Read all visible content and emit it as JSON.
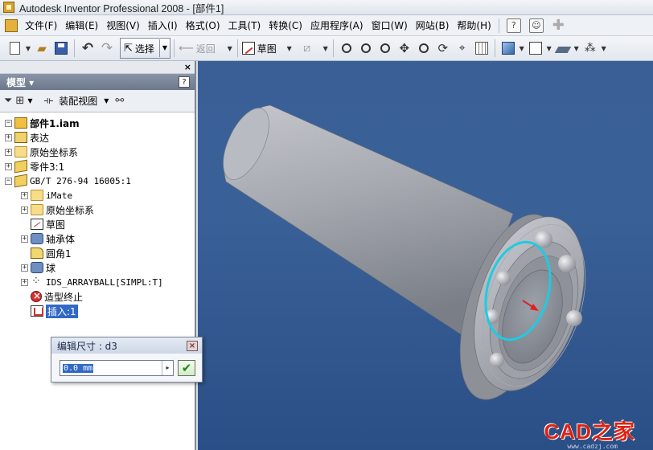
{
  "window": {
    "title": "Autodesk Inventor Professional 2008 - [部件1]"
  },
  "menu": {
    "items": [
      "文件(F)",
      "编辑(E)",
      "视图(V)",
      "插入(I)",
      "格式(O)",
      "工具(T)",
      "转换(C)",
      "应用程序(A)",
      "窗口(W)",
      "网站(B)",
      "帮助(H)"
    ],
    "help_icon": "?"
  },
  "toolbar": {
    "select_label": "选择",
    "back_label": "返回",
    "sketch_label": "草图"
  },
  "browser": {
    "header": "模型 ▾",
    "help": "?",
    "close": "×",
    "assembly_view_label": "装配视图",
    "tree": [
      {
        "label": "部件1.iam"
      },
      {
        "label": "表达"
      },
      {
        "label": "原始坐标系"
      },
      {
        "label": "零件3:1"
      },
      {
        "label": "GB/T 276-94 16005:1"
      },
      {
        "label": "iMate"
      },
      {
        "label": "原始坐标系"
      },
      {
        "label": "草图"
      },
      {
        "label": "轴承体"
      },
      {
        "label": "圆角1"
      },
      {
        "label": "球"
      },
      {
        "label": "IDS_ARRAYBALL[SIMPL:T]"
      },
      {
        "label": "造型终止"
      },
      {
        "label": "插入:1"
      }
    ]
  },
  "dialog": {
    "title": "编辑尺寸 : d3",
    "value": "0.0 mm"
  },
  "watermark": {
    "text": "CAD之家",
    "url": "www.cadzj.com"
  },
  "colors": {
    "viewport_bg": "#3a5f97",
    "selection": "#3169c6",
    "highlight_circle": "#20c8e0"
  }
}
